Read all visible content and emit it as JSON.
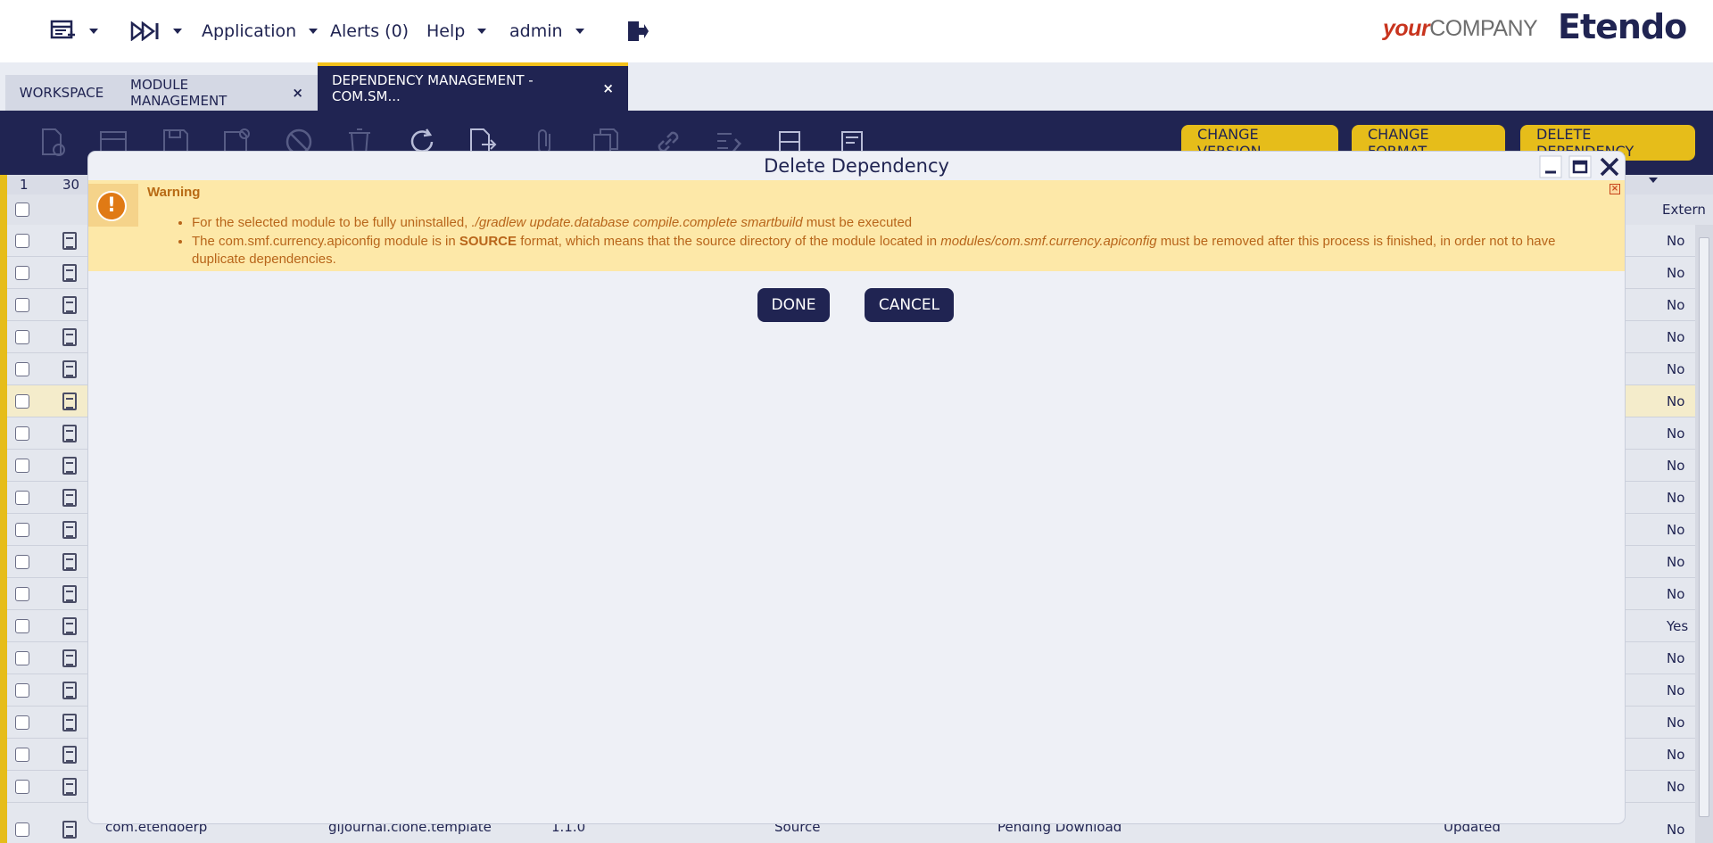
{
  "topnav": {
    "application": "Application",
    "alerts": "Alerts (0)",
    "help": "Help",
    "user": "admin",
    "brand_your": "your",
    "brand_company": "COMPANY",
    "brand_etendo": "Etendo"
  },
  "tabs": [
    {
      "label": "WORKSPACE"
    },
    {
      "label": "MODULE MANAGEMENT",
      "close": "×"
    },
    {
      "label": "DEPENDENCY MANAGEMENT - COM.SM...",
      "close": "×"
    }
  ],
  "toolbar": {
    "change_version": "CHANGE VERSION",
    "change_format": "CHANGE FORMAT",
    "delete_dependency": "DELETE DEPENDENCY"
  },
  "grid": {
    "header_page": "1",
    "header_size": "30",
    "column_external": "Extern",
    "rows": [
      "No",
      "No",
      "No",
      "No",
      "No",
      "No",
      "No",
      "No",
      "No",
      "No",
      "No",
      "No",
      "Yes",
      "No",
      "No",
      "No",
      "No",
      "No",
      "No"
    ],
    "last_row": {
      "group": "com.etendoerp",
      "java_package": "gljournal.clone.template",
      "version": "1.1.0",
      "format": "Source",
      "status": "Pending Download",
      "update": "Updated"
    }
  },
  "modal": {
    "title": "Delete Dependency",
    "warning_title": "Warning",
    "line1_prefix": "For the selected module to be fully uninstalled, ",
    "line1_command": "./gradlew update.database compile.complete smartbuild",
    "line1_suffix": " must be executed",
    "line2_a": "The com.smf.currency.apiconfig module is in ",
    "line2_format": "SOURCE",
    "line2_b": " format, which means that the source directory of the module located in ",
    "line2_path": "modules/com.smf.currency.apiconfig",
    "line2_c": " must be removed after this process is finished, in order not to have duplicate dependencies.",
    "done": "DONE",
    "cancel": "CANCEL"
  },
  "colors": {
    "navy": "#202452",
    "accent_yellow": "#e6bd1a",
    "warning_bg": "#fde8a8",
    "warning_text": "#b8651a"
  }
}
